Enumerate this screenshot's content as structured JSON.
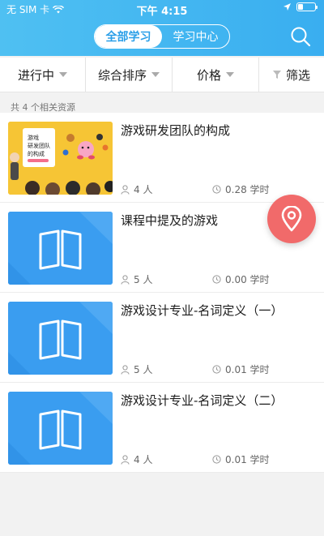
{
  "status_bar": {
    "carrier": "无 SIM 卡",
    "time": "下午 4:15",
    "battery_level": 0.3
  },
  "header": {
    "tabs": [
      {
        "label": "全部学习",
        "active": true
      },
      {
        "label": "学习中心",
        "active": false
      }
    ],
    "search_icon": "search-icon"
  },
  "filters": [
    {
      "label": "进行中"
    },
    {
      "label": "综合排序"
    },
    {
      "label": "价格"
    },
    {
      "label": "筛选"
    }
  ],
  "result_count": "共 4 个相关资源",
  "items": [
    {
      "title": "游戏研发团队的构成",
      "learners": "4 人",
      "hours": "0.28 学时",
      "thumb": "game",
      "thumb_text": "游戏\n研发团队\n的构成"
    },
    {
      "title": "课程中提及的游戏",
      "learners": "5 人",
      "hours": "0.00 学时",
      "thumb": "book"
    },
    {
      "title": "游戏设计专业-名词定义（一）",
      "learners": "5 人",
      "hours": "0.01 学时",
      "thumb": "book"
    },
    {
      "title": "游戏设计专业-名词定义（二）",
      "learners": "4 人",
      "hours": "0.01 学时",
      "thumb": "book"
    }
  ],
  "colors": {
    "header": "#3fb3f1",
    "accent": "#2b9fe8",
    "fab": "#f16a6a",
    "thumb_blue": "#3a9df0"
  }
}
